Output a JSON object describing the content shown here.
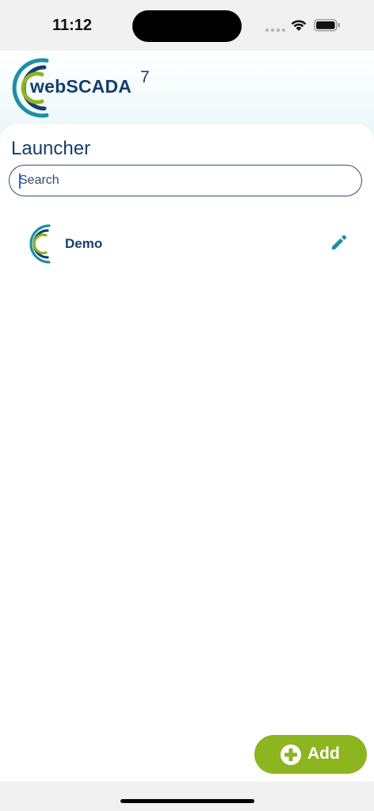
{
  "status_bar": {
    "time": "11:12",
    "icons": [
      "cellular-signal-icon",
      "wifi-icon",
      "battery-icon"
    ]
  },
  "header": {
    "logo_icon": "webscada-logo-icon",
    "brand": "webSCADA",
    "version": "7"
  },
  "launcher": {
    "title": "Launcher",
    "search": {
      "placeholder": "Search",
      "value": ""
    },
    "items": [
      {
        "label": "Demo",
        "icon": "webscada-logo-icon",
        "action_icon": "pencil-edit-icon"
      }
    ]
  },
  "add_button": {
    "label": "Add",
    "icon": "plus-circle-icon"
  },
  "colors": {
    "brand_navy": "#163e6e",
    "brand_teal": "#1d8fa5",
    "brand_green": "#8cb51f",
    "background": "#ffffff"
  }
}
